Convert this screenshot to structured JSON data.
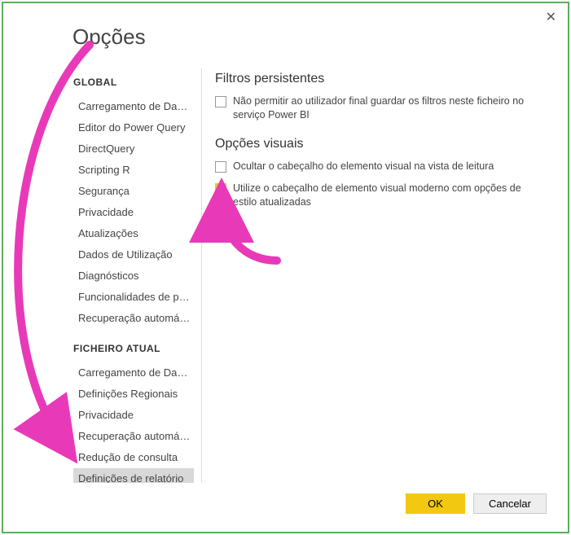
{
  "dialog": {
    "title": "Opções"
  },
  "sidebar": {
    "sections": [
      {
        "header": "GLOBAL",
        "items": [
          "Carregamento de Dados",
          "Editor do Power Query",
          "DirectQuery",
          "Scripting R",
          "Segurança",
          "Privacidade",
          "Atualizações",
          "Dados de Utilização",
          "Diagnósticos",
          "Funcionalidades de pré...",
          "Recuperação automática"
        ]
      },
      {
        "header": "FICHEIRO ATUAL",
        "items": [
          "Carregamento de Dados",
          "Definições Regionais",
          "Privacidade",
          "Recuperação automática",
          "Redução de consulta",
          "Definições de relatório"
        ]
      }
    ],
    "selected": "Definições de relatório"
  },
  "content": {
    "group1": {
      "title": "Filtros persistentes",
      "opt1": {
        "checked": false,
        "label": "Não permitir ao utilizador final guardar os filtros neste ficheiro no serviço Power BI"
      }
    },
    "group2": {
      "title": "Opções visuais",
      "opt1": {
        "checked": false,
        "label": "Ocultar o cabeçalho do elemento visual na vista de leitura"
      },
      "opt2": {
        "checked": true,
        "label": "Utilize o cabeçalho de elemento visual moderno com opções de estilo atualizadas"
      }
    }
  },
  "footer": {
    "ok": "OK",
    "cancel": "Cancelar"
  },
  "colors": {
    "accent": "#f2c811",
    "annotation": "#e83ab8"
  }
}
